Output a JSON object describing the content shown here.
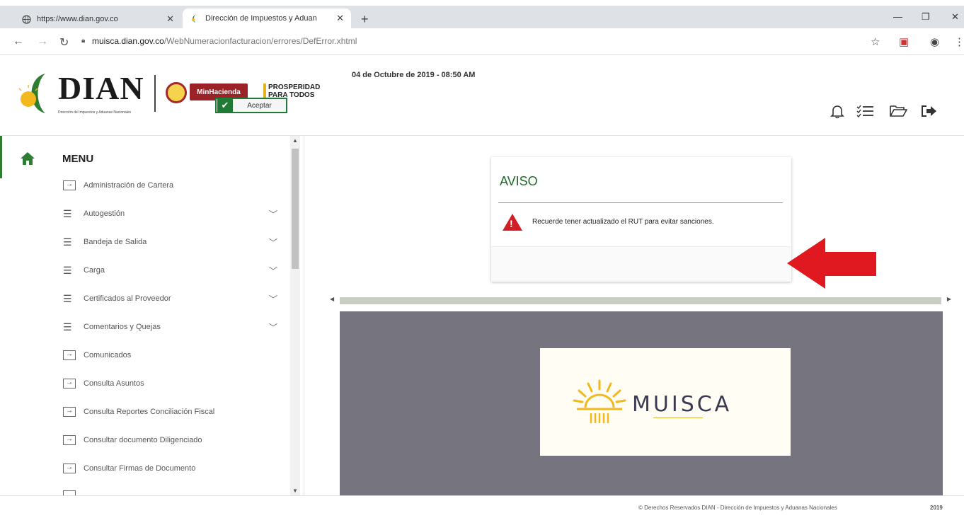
{
  "browser": {
    "tabs": [
      {
        "title": "https://www.dian.gov.co",
        "favicon": "globe-icon"
      },
      {
        "title": "Dirección de Impuestos y Aduan",
        "favicon": "dian-favicon",
        "active": true
      }
    ],
    "url_host": "muisca.dian.gov.co",
    "url_path": "/WebNumeracionfacturacion/errores/DefError.xhtml"
  },
  "header": {
    "logo_text": "DIAN",
    "logo_subtitle": "Dirección de Impuestos y Aduanas Nacionales",
    "minhacienda_label": "MinHacienda",
    "prosperidad_line1": "PROSPERIDAD",
    "prosperidad_line2": "PARA TODOS",
    "datetime": "04 de Octubre de 2019 - 08:50 AM"
  },
  "sidebar": {
    "menu_title": "MENU",
    "items": [
      {
        "label": "Administración de Cartera",
        "icon": "box-arrow-icon",
        "expandable": false
      },
      {
        "label": "Autogestión",
        "icon": "hamburger-icon",
        "expandable": true
      },
      {
        "label": "Bandeja de Salida",
        "icon": "hamburger-icon",
        "expandable": true
      },
      {
        "label": "Carga",
        "icon": "hamburger-icon",
        "expandable": true
      },
      {
        "label": "Certificados al Proveedor",
        "icon": "hamburger-icon",
        "expandable": true
      },
      {
        "label": "Comentarios y Quejas",
        "icon": "hamburger-icon",
        "expandable": true
      },
      {
        "label": "Comunicados",
        "icon": "box-arrow-icon",
        "expandable": false
      },
      {
        "label": "Consulta Asuntos",
        "icon": "box-arrow-icon",
        "expandable": false
      },
      {
        "label": "Consulta Reportes Conciliación Fiscal",
        "icon": "box-arrow-icon",
        "expandable": false
      },
      {
        "label": "Consultar documento Diligenciado",
        "icon": "box-arrow-icon",
        "expandable": false
      },
      {
        "label": "Consultar Firmas de Documento",
        "icon": "box-arrow-icon",
        "expandable": false
      }
    ]
  },
  "dialog": {
    "title": "AVISO",
    "message": "Recuerde tener actualizado el RUT para evitar sanciones.",
    "accept_label": "Aceptar"
  },
  "muisca": {
    "wordmark": "MUISCA"
  },
  "footer": {
    "copyright": "© Derechos Reservados DIAN - Dirección de Impuestos y Aduanas Nacionales",
    "year": "2019"
  },
  "colors": {
    "accent_green": "#1f7a35",
    "warning_red": "#d21f25",
    "pane_gray": "#76757f"
  }
}
